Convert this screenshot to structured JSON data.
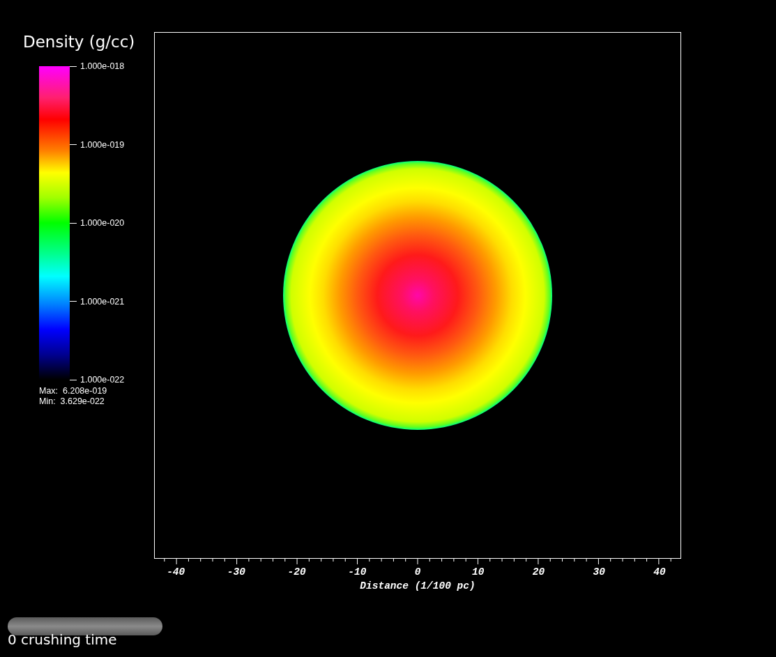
{
  "legend": {
    "title": "Density (g/cc)",
    "labels": [
      "1.000e-018",
      "1.000e-019",
      "1.000e-020",
      "1.000e-021",
      "1.000e-022"
    ],
    "max": "Max:  6.208e-019",
    "min": "Min:  3.629e-022"
  },
  "plot": {
    "x_axis": {
      "tick_labels": [
        "-40",
        "-30",
        "-20",
        "-10",
        "0",
        "10",
        "20",
        "30",
        "40"
      ],
      "title": "Distance (1/100 pc)"
    }
  },
  "time_slider": {
    "level": 0,
    "label": "0 crushing time"
  }
}
